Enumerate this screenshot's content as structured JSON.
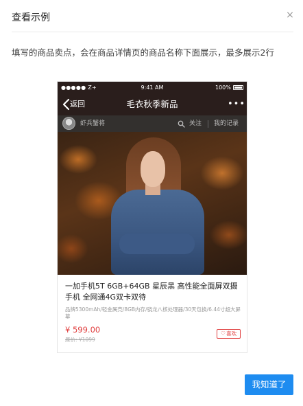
{
  "dialog": {
    "title": "查看示例",
    "close_symbol": "×",
    "description": "填写的商品卖点，会在商品详情页的商品名称下面展示，最多展示2行",
    "confirm_label": "我知道了"
  },
  "preview": {
    "status_bar": {
      "carrier": "●●●●● Z+",
      "time": "9:41 AM",
      "battery": "100%"
    },
    "nav": {
      "back_label": "返回",
      "title": "毛衣秋季新品",
      "more_symbol": "•••"
    },
    "shop": {
      "name": "虾兵蟹将",
      "follow_label": "关注",
      "records_label": "我的记录"
    },
    "product": {
      "title": "一加手机5T 6GB+64GB 星辰黑 高性能全面屏双摄手机 全网通4G双卡双待",
      "specs": "品牌5300mAh/轻金属壳/8GB内存/骁龙八核处理器/30天包换/6.44寸超大屏幕",
      "price": "¥ 599.00",
      "original_price": "原价: ¥1099",
      "like_label": "喜欢",
      "like_symbol": "♡"
    }
  },
  "colors": {
    "primary": "#1e8cf0",
    "price_red": "#e03c3c",
    "nav_dark": "#2a1e1c"
  }
}
